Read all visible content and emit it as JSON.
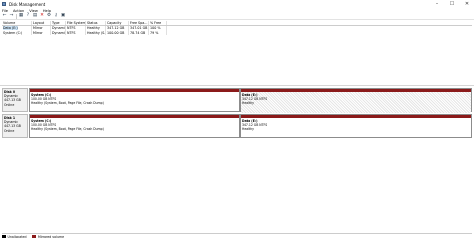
{
  "window": {
    "title": "Disk Management"
  },
  "menu": [
    "File",
    "Action",
    "View",
    "Help"
  ],
  "toolbar": [
    "back",
    "forward",
    "details",
    "help",
    "list",
    "close",
    "settings",
    "key",
    "properties"
  ],
  "volumes": {
    "headers": [
      "Volume",
      "Layout",
      "Type",
      "File System",
      "Status",
      "Capacity",
      "Free Spa...",
      "% Free"
    ],
    "rows": [
      {
        "volume": "Data (E:)",
        "layout": "Mirror",
        "type": "Dynamic",
        "fs": "NTFS",
        "status": "Healthy",
        "capacity": "347.12 GB",
        "free": "347.01 GB",
        "pct": "100 %"
      },
      {
        "volume": "System (C:)",
        "layout": "Mirror",
        "type": "Dynamic",
        "fs": "NTFS",
        "status": "Healthy (S...",
        "capacity": "100.00 GB",
        "free": "78.74 GB",
        "pct": "79 %"
      }
    ]
  },
  "disks": [
    {
      "name": "Disk 0",
      "type": "Dynamic",
      "size": "447.13 GB",
      "status": "Online",
      "partitions": [
        {
          "name": "System (C:)",
          "size": "100.00 GB NTFS",
          "status": "Healthy (System, Boot, Page File, Crash Dump)"
        },
        {
          "name": "Data (E:)",
          "size": "347.12 GB NTFS",
          "status": "Healthy"
        }
      ]
    },
    {
      "name": "Disk 1",
      "type": "Dynamic",
      "size": "447.13 GB",
      "status": "Online",
      "partitions": [
        {
          "name": "System (C:)",
          "size": "100.00 GB NTFS",
          "status": "Healthy (System, Boot, Page File, Crash Dump)"
        },
        {
          "name": "Data (E:)",
          "size": "347.12 GB NTFS",
          "status": "Healthy"
        }
      ]
    }
  ],
  "legend": {
    "unallocated": "Unallocated",
    "mirrored": "Mirrored volume"
  },
  "colors": {
    "mirrored": "#8b1a1a",
    "unallocated": "#000000",
    "selection": "#cce4f7"
  }
}
